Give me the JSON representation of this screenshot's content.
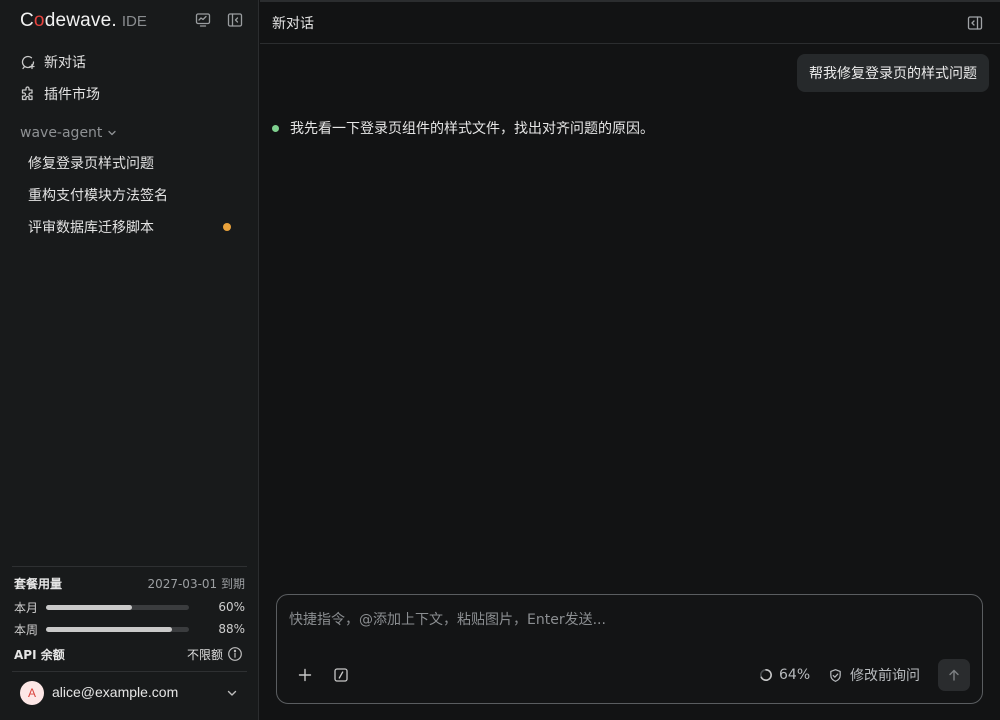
{
  "app": {
    "brand_c": "C",
    "brand_o": "o",
    "brand_rest": "dewave",
    "brand_suffix": ".",
    "product": "IDE"
  },
  "sidebar": {
    "nav": [
      {
        "label": "新对话",
        "icon": "new-chat-icon"
      },
      {
        "label": "插件市场",
        "icon": "puzzle-icon"
      }
    ],
    "workspace_label": "wave-agent",
    "conversations": [
      {
        "label": "修复登录页样式问题",
        "unread": false
      },
      {
        "label": "重构支付模块方法签名",
        "unread": false
      },
      {
        "label": "评审数据库迁移脚本",
        "unread": true
      }
    ],
    "unread_color": "#e9a23b"
  },
  "usage": {
    "title": "套餐用量",
    "expiry": "2027-03-01 到期",
    "month_label": "本月",
    "month_value": 0.6,
    "month_pct": "60%",
    "week_label": "本周",
    "week_value": 0.88,
    "week_pct": "88%",
    "api_label": "API 余额",
    "api_value": "不限额"
  },
  "user": {
    "avatar_letter": "A",
    "email": "alice@example.com"
  },
  "main": {
    "title": "新对话",
    "user_message": "帮我修复登录页的样式问题",
    "assistant_message": "我先看一下登录页组件的样式文件，找出对齐问题的原因。",
    "assistant_dot_color": "#7fd08f"
  },
  "composer": {
    "placeholder": "快捷指令，@添加上下文，粘贴图片，Enter发送...",
    "value": "",
    "context_usage": "64%",
    "approval_mode": "修改前询问"
  }
}
